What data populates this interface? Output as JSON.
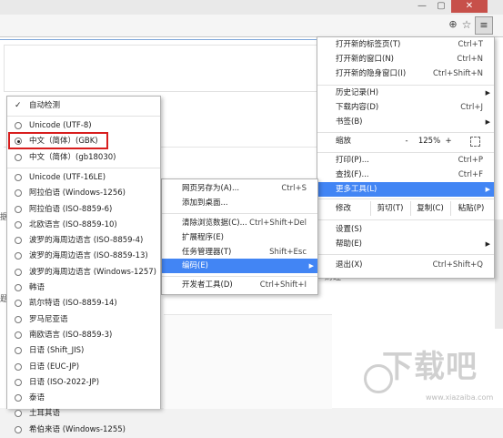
{
  "window": {
    "minimize": "—",
    "maximize": "▢",
    "close": "✕"
  },
  "toolbar": {
    "zoom_icon": "⊕",
    "star_icon": "☆",
    "menu_icon": "≡"
  },
  "background": {
    "snippet_left_1": "据",
    "snippet_left_2": "题",
    "snippet_bottom": "财经"
  },
  "main_menu": {
    "items_top": [
      {
        "label": "打开新的标签页(T)",
        "shortcut": "Ctrl+T"
      },
      {
        "label": "打开新的窗口(N)",
        "shortcut": "Ctrl+N"
      },
      {
        "label": "打开新的隐身窗口(I)",
        "shortcut": "Ctrl+Shift+N"
      }
    ],
    "items_history": [
      {
        "label": "历史记录(H)",
        "arrow": "▶"
      },
      {
        "label": "下载内容(D)",
        "shortcut": "Ctrl+J"
      },
      {
        "label": "书签(B)",
        "arrow": "▶"
      }
    ],
    "zoom": {
      "label": "缩放",
      "minus": "-",
      "value": "125%",
      "plus": "+"
    },
    "items_tools": [
      {
        "label": "打印(P)...",
        "shortcut": "Ctrl+P"
      },
      {
        "label": "查找(F)...",
        "shortcut": "Ctrl+F"
      },
      {
        "label": "更多工具(L)",
        "arrow": "▶"
      }
    ],
    "edit": {
      "label": "修改",
      "cut": "剪切(T)",
      "copy": "复制(C)",
      "paste": "粘贴(P)"
    },
    "items_settings": [
      {
        "label": "设置(S)"
      },
      {
        "label": "帮助(E)",
        "arrow": "▶"
      }
    ],
    "exit": {
      "label": "退出(X)",
      "shortcut": "Ctrl+Shift+Q"
    }
  },
  "sub_menu": {
    "items": [
      {
        "label": "网页另存为(A)...",
        "shortcut": "Ctrl+S"
      },
      {
        "label": "添加到桌面..."
      },
      {
        "label": "清除浏览数据(C)...",
        "shortcut": "Ctrl+Shift+Del"
      },
      {
        "label": "扩展程序(E)"
      },
      {
        "label": "任务管理器(T)",
        "shortcut": "Shift+Esc"
      },
      {
        "label": "编码(E)",
        "arrow": "▶"
      },
      {
        "label": "开发者工具(D)",
        "shortcut": "Ctrl+Shift+I"
      }
    ]
  },
  "encoding_menu": {
    "auto_detect": "自动检测",
    "check": "✓",
    "items": [
      "Unicode (UTF-8)",
      "中文（简体）(GBK)",
      "中文（简体）(gb18030)",
      "Unicode (UTF-16LE)",
      "阿拉伯语 (Windows-1256)",
      "阿拉伯语 (ISO-8859-6)",
      "北欧语言 (ISO-8859-10)",
      "波罗的海周边语言 (ISO-8859-4)",
      "波罗的海周边语言 (ISO-8859-13)",
      "波罗的海周边语言 (Windows-1257)",
      "韩语",
      "凯尔特语 (ISO-8859-14)",
      "罗马尼亚语",
      "南欧语言 (ISO-8859-3)",
      "日语 (Shift_JIS)",
      "日语 (EUC-JP)",
      "日语 (ISO-2022-JP)",
      "泰语",
      "土耳其语",
      "希伯来语 (Windows-1255)"
    ],
    "selected": "中文（简体）(GBK)"
  },
  "watermark": {
    "text": "下载吧",
    "url": "www.xiazaiba.com"
  },
  "colors": {
    "highlight": "#4285f4",
    "annotation": "#d81e1e",
    "close": "#c7504a"
  }
}
